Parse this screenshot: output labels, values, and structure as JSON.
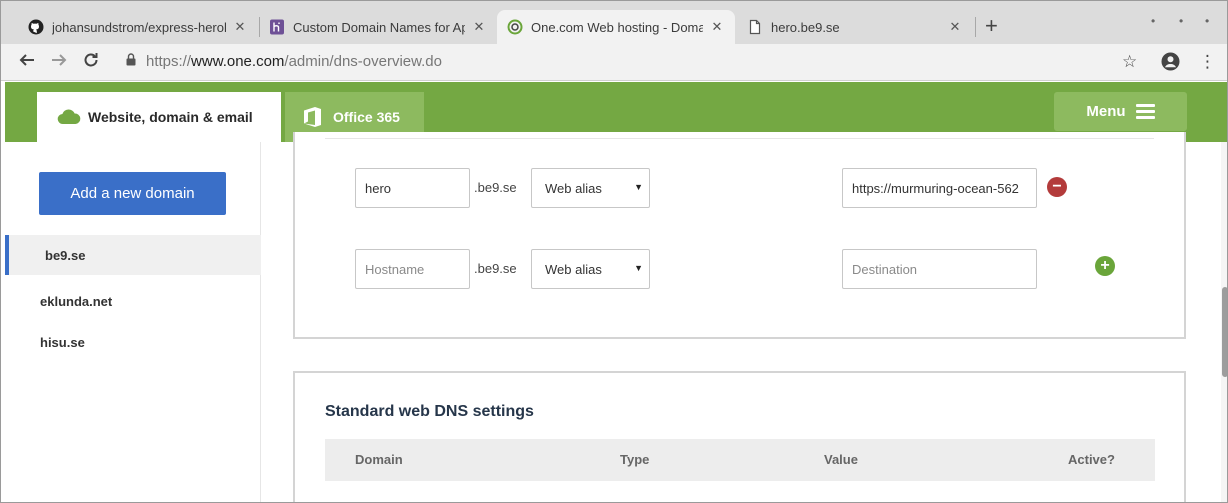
{
  "browser": {
    "tabs": [
      {
        "title": "johansundstrom/express-herok",
        "icon": "github-icon",
        "active": false
      },
      {
        "title": "Custom Domain Names for Apps",
        "icon": "heroku-icon",
        "active": false
      },
      {
        "title": "One.com Web hosting  -  Domai",
        "icon": "onecom-icon",
        "active": true
      },
      {
        "title": "hero.be9.se",
        "icon": "page-icon",
        "active": false
      }
    ],
    "url_scheme": "https://",
    "url_host": "www.one.com",
    "url_path": "/admin/dns-overview.do"
  },
  "header": {
    "main_tab_label": "Website, domain & email",
    "office_tab_label": "Office 365",
    "menu_label": "Menu",
    "accent_color": "#74a843"
  },
  "sidebar": {
    "add_domain_label": "Add a new domain",
    "domains": [
      {
        "label": "be9.se",
        "active": true
      },
      {
        "label": "eklunda.net",
        "active": false
      },
      {
        "label": "hisu.se",
        "active": false
      }
    ]
  },
  "records": {
    "existing": {
      "hostname_value": "hero",
      "suffix": ".be9.se",
      "type_value": "Web alias",
      "destination_value": "https://murmuring-ocean-562"
    },
    "new": {
      "hostname_placeholder": "Hostname",
      "suffix": ".be9.se",
      "type_value": "Web alias",
      "destination_placeholder": "Destination"
    }
  },
  "standard_dns": {
    "title": "Standard web DNS settings",
    "columns": [
      "Domain",
      "Type",
      "Value",
      "Active?"
    ]
  }
}
